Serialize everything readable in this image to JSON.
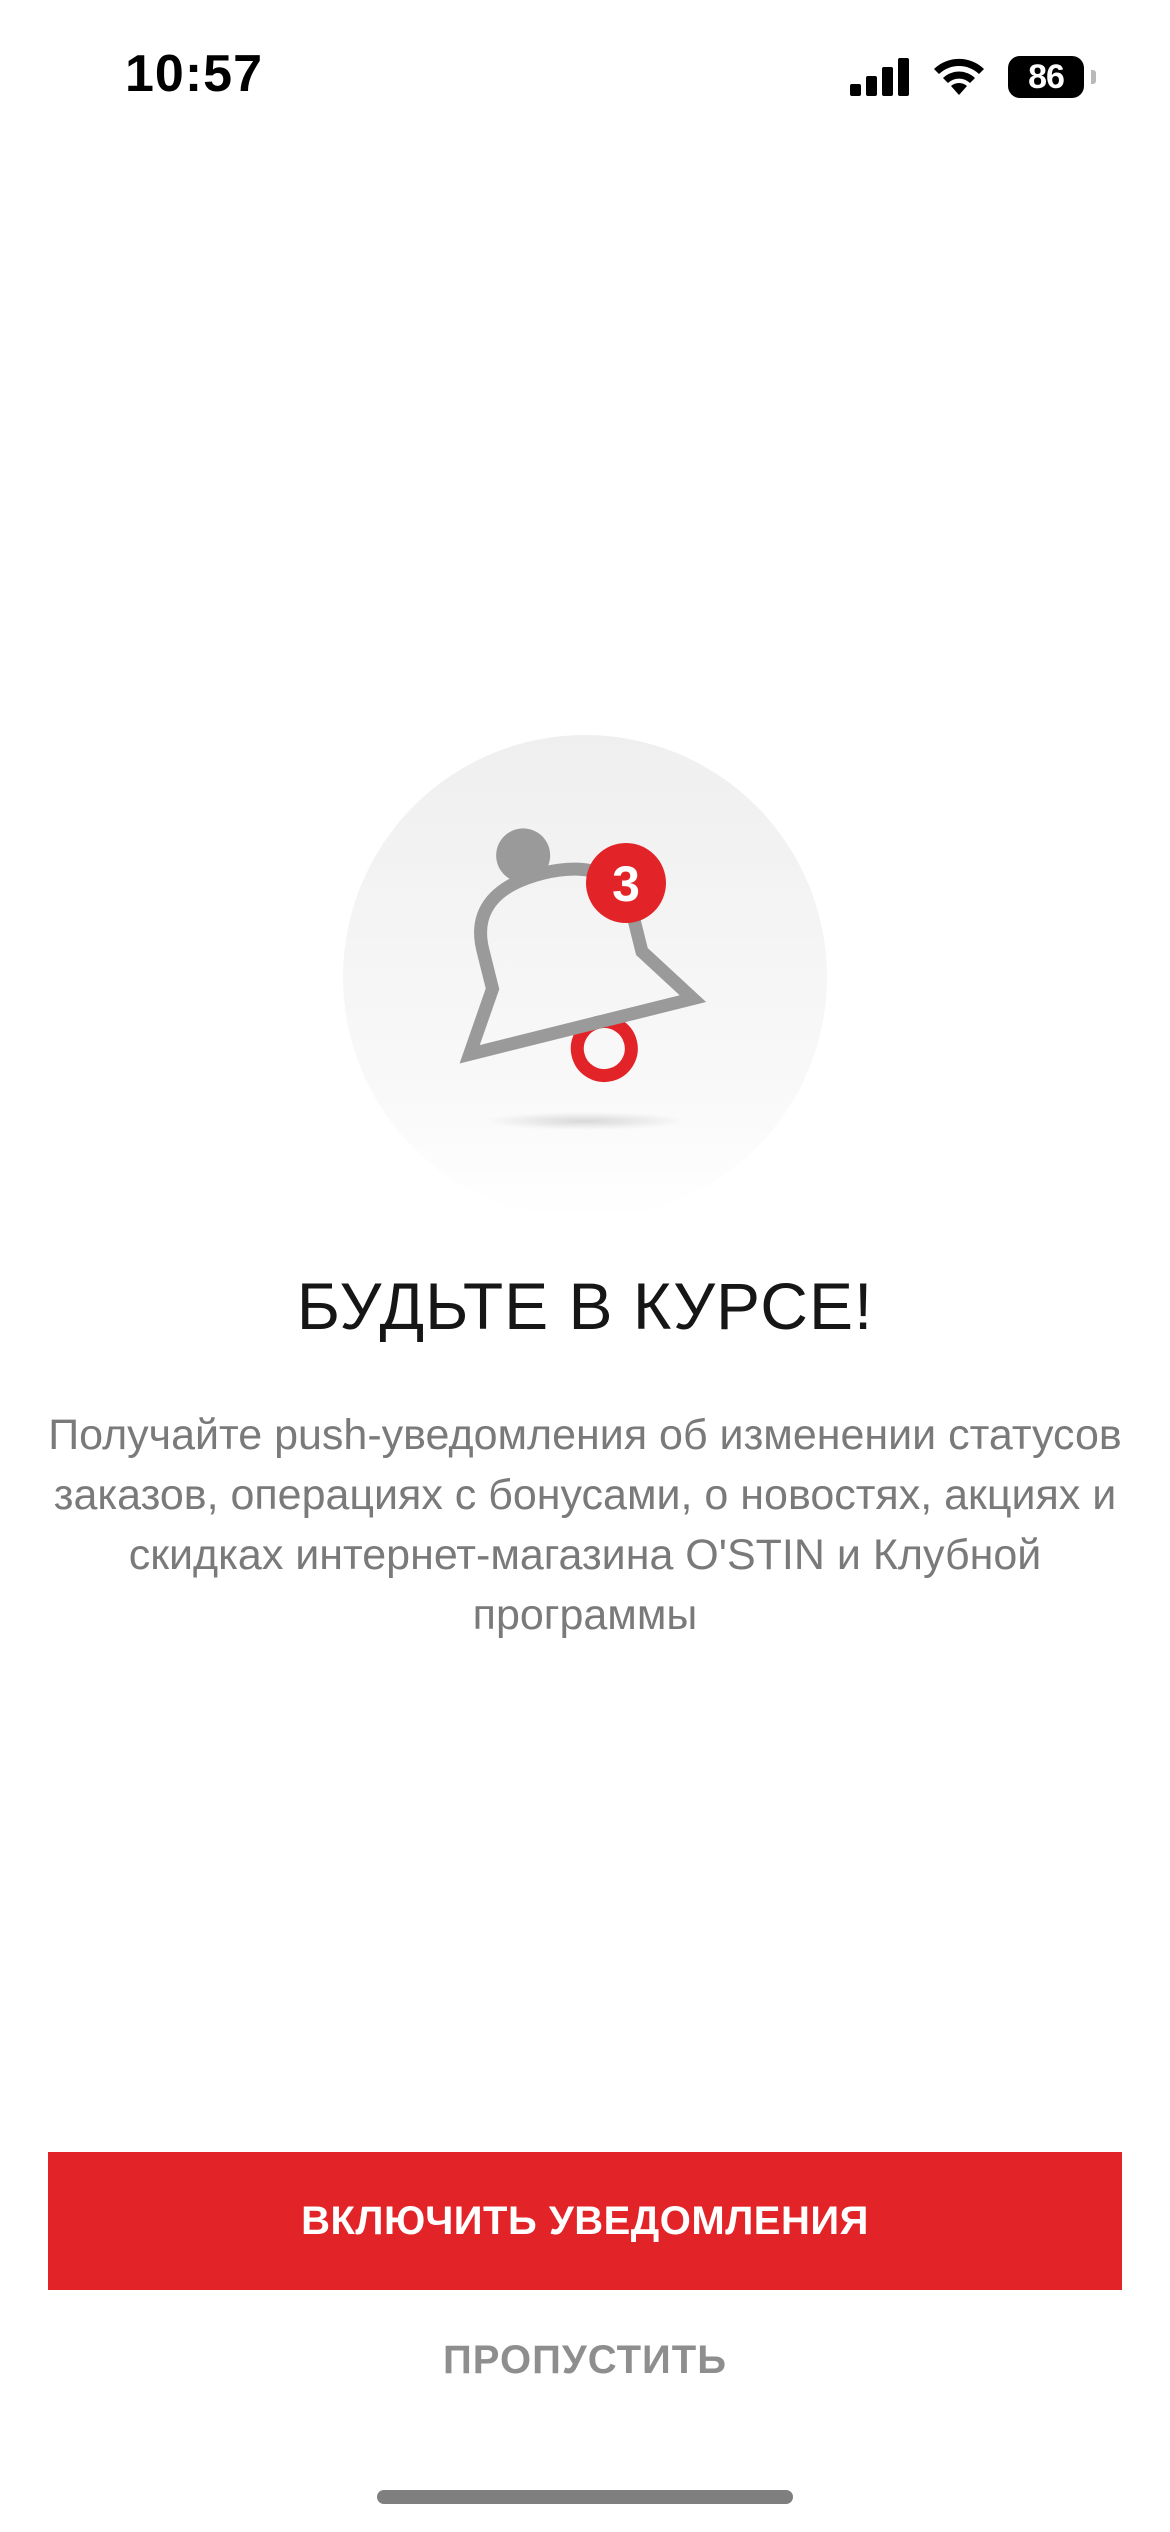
{
  "status_bar": {
    "time": "10:57",
    "battery_level": "86",
    "icons": [
      "signal-icon",
      "wifi-icon",
      "battery-icon"
    ]
  },
  "illustration": {
    "icon": "bell-icon",
    "badge_count": "3",
    "accent_color": "#e22428"
  },
  "content": {
    "title": "БУДЬТЕ В КУРСЕ!",
    "description": "Получайте push-уведомления об изменении статусов заказов, операциях с бонусами, о новостях, акциях и скидках интернет-магазина O'STIN и Клубной программы"
  },
  "actions": {
    "enable_label": "ВКЛЮЧИТЬ УВЕДОМЛЕНИЯ",
    "skip_label": "ПРОПУСТИТЬ"
  },
  "colors": {
    "primary": "#e22428",
    "muted_text": "#7a7a7a",
    "bell_gray": "#999999"
  }
}
